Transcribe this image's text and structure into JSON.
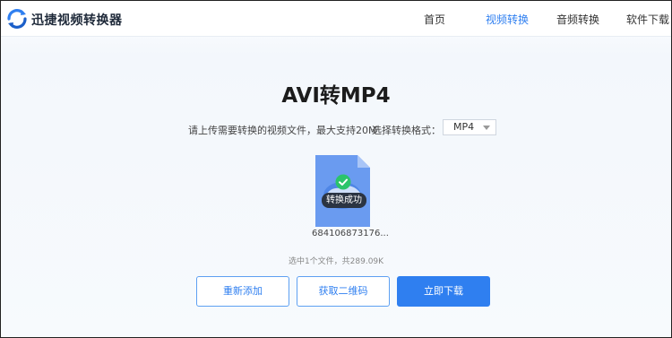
{
  "header": {
    "brand": "迅捷视频转换器",
    "nav": [
      {
        "label": "首页",
        "active": false
      },
      {
        "label": "视频转换",
        "active": true
      },
      {
        "label": "音频转换",
        "active": false
      },
      {
        "label": "软件下载",
        "active": false
      }
    ]
  },
  "main": {
    "title": "AVI转MP4",
    "hint": "请上传需要转换的视频文件，最大支持20M",
    "format_label": "选择转换格式：",
    "format_value": "MP4"
  },
  "file": {
    "status": "转换成功",
    "name": "684106873176...",
    "summary": "选中1个文件，共289.09K"
  },
  "actions": {
    "add": "重新添加",
    "qr": "获取二维码",
    "download": "立即下载"
  },
  "colors": {
    "accent": "#2f7ff0",
    "success": "#2bc46b",
    "file": "#6a9bf0"
  }
}
